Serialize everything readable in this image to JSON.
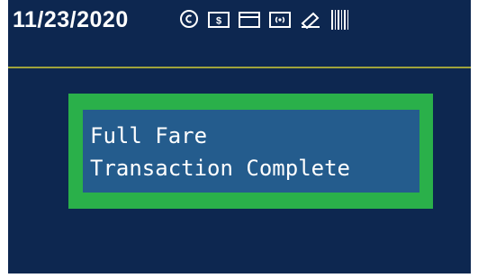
{
  "status_bar": {
    "date": "11/23/2020",
    "icons": [
      "coin-icon",
      "cash-bill-icon",
      "card-icon",
      "contactless-icon",
      "mobile-ticket-icon",
      "barcode-icon"
    ]
  },
  "message": {
    "line1": "Full Fare",
    "line2": "Transaction Complete"
  },
  "colors": {
    "background": "#0d2750",
    "frame": "#2ab04a",
    "panel": "#245c8d",
    "divider": "#9fa33c",
    "text": "#ffffff"
  }
}
